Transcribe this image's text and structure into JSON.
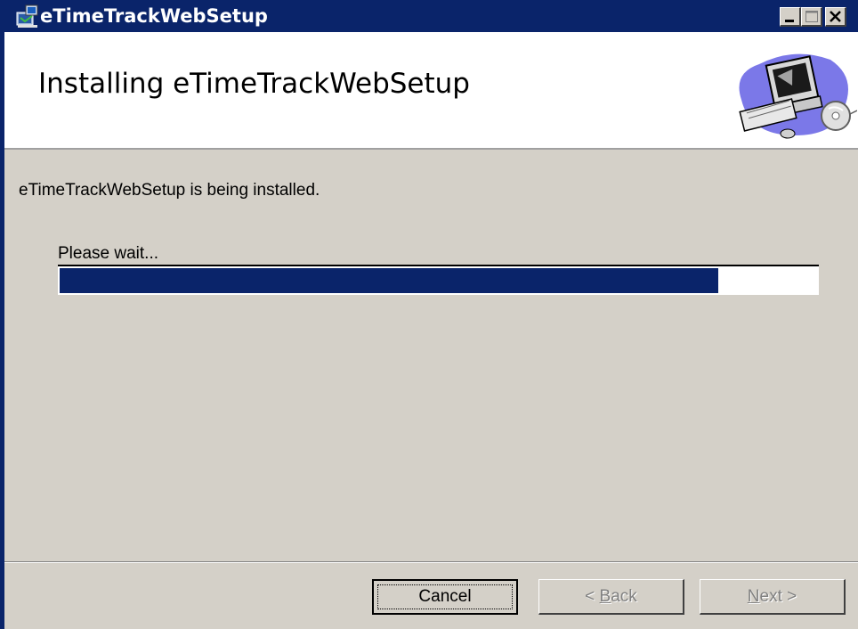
{
  "window": {
    "title": "eTimeTrackWebSetup",
    "titlebar_color": "#0a246a",
    "app_icon": "installer-icon",
    "controls": {
      "minimize_icon": "minimize-icon",
      "maximize_icon": "maximize-icon",
      "close_icon": "close-icon"
    }
  },
  "banner": {
    "title": "Installing eTimeTrackWebSetup",
    "art_icon": "computer-cd-icon"
  },
  "body": {
    "status": "eTimeTrackWebSetup is being installed.",
    "wait_label": "Please wait...",
    "progress_fraction": 0.87,
    "progress_color": "#0a246a"
  },
  "buttons": {
    "cancel": "Cancel",
    "back": {
      "prefix": "< ",
      "accel": "B",
      "rest": "ack"
    },
    "next": {
      "accel": "N",
      "rest": "ext >"
    }
  }
}
